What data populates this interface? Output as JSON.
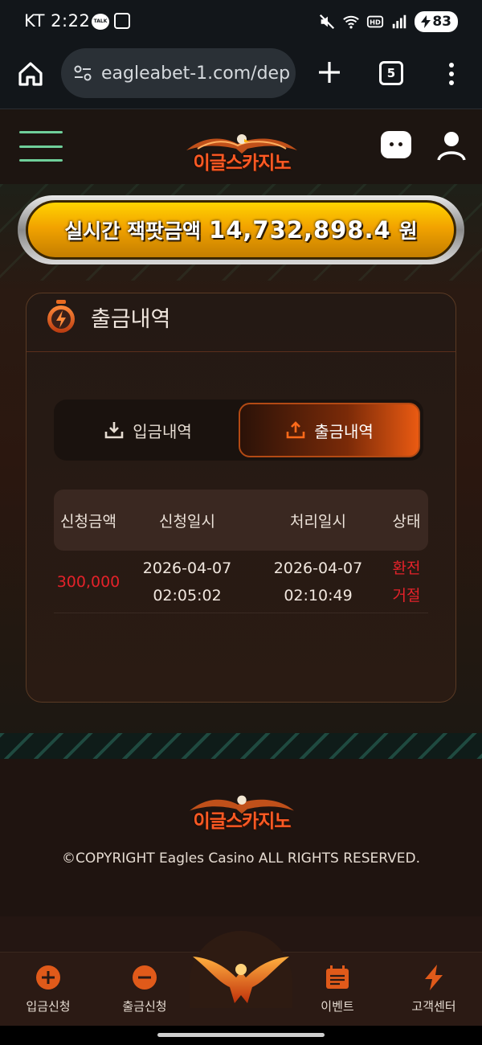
{
  "status": {
    "time": "KT 2:22",
    "battery": "83",
    "kakao": "TALK"
  },
  "browser": {
    "url": "eagleabet-1.com/dep",
    "tab_count": "5"
  },
  "site": {
    "logo_text": "이글스카지노"
  },
  "jackpot": {
    "label": "실시간 잭팟금액",
    "value": "14,732,898.4",
    "unit": "원"
  },
  "card": {
    "title": "출금내역",
    "tabs": {
      "deposit_label": "입금내역",
      "withdraw_label": "출금내역"
    },
    "table": {
      "headers": [
        "신청금액",
        "신청일시",
        "처리일시",
        "상태"
      ],
      "rows": [
        {
          "amount": "300,000",
          "request_date": "2026-04-07",
          "request_time": "02:05:02",
          "process_date": "2026-04-07",
          "process_time": "02:10:49",
          "status_line1": "환전",
          "status_line2": "거절"
        }
      ]
    }
  },
  "footer": {
    "logo_text": "이글스카지노",
    "copyright": "©COPYRIGHT Eagles Casino ALL RIGHTS RESERVED."
  },
  "bottom_nav": {
    "deposit": "입금신청",
    "withdraw": "출금신청",
    "event": "이벤트",
    "support": "고객센터"
  },
  "colors": {
    "accent_orange": "#ea5a12",
    "status_red": "#e4222a",
    "jackpot_gold": "#ffd300",
    "menu_green": "#6fcf9a"
  }
}
